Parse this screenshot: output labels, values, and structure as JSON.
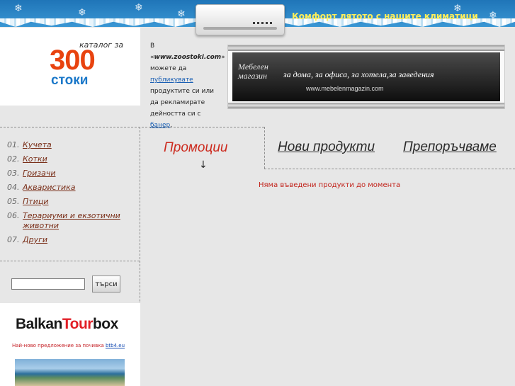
{
  "header": {
    "promo_text": "Комфорт лятото с нашите климатици"
  },
  "logo": {
    "small": "каталог за",
    "number": "300",
    "word": "стоки"
  },
  "ad_info": {
    "part1": "В «",
    "site": "www.zoostoki.com",
    "part2": "» можете да ",
    "link_publish": "публикувате",
    "part3": " продуктите си или да рекламирате дейността си с ",
    "link_banner": "банер",
    "part4": "."
  },
  "banner": {
    "brand": "Мебелен магазин",
    "slogan": "за дома, за офиса, за хотела,за заведения",
    "url": "www.mebelenmagazin.com"
  },
  "categories": [
    {
      "num": "01.",
      "label": "Кучета"
    },
    {
      "num": "02.",
      "label": "Котки"
    },
    {
      "num": "03.",
      "label": "Гризачи"
    },
    {
      "num": "04.",
      "label": "Аквaристика"
    },
    {
      "num": "05.",
      "label": "Птици"
    },
    {
      "num": "06.",
      "label": "Терариуми и екзотични животни"
    },
    {
      "num": "07.",
      "label": "Други"
    }
  ],
  "search": {
    "value": "",
    "button": "търси"
  },
  "balkan": {
    "logo_a": "Balkan",
    "logo_b": "Tour",
    "logo_c": "box",
    "text": "Най-ново предложение за почивка ",
    "link": "btb4.eu"
  },
  "tabs": {
    "promo": "Промоции",
    "new": "Нови продукти",
    "recommend": "Препоръчваме",
    "arrow": "↓"
  },
  "empty_message": "Няма въведени продукти до момента",
  "colors": {
    "accent_red": "#cc2a1e",
    "header_blue": "#2f86c4",
    "link_blue": "#1a5fb4"
  }
}
